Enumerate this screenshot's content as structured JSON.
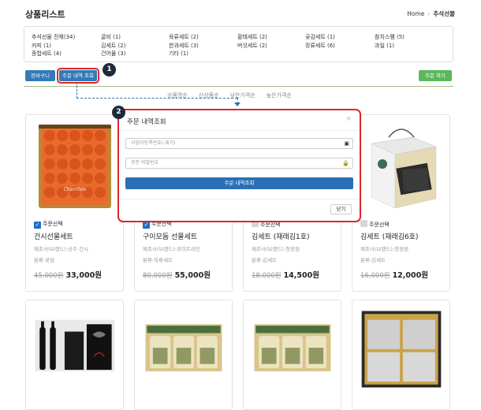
{
  "header": {
    "title": "상품리스트",
    "breadcrumb": [
      "Home",
      "추석선물"
    ]
  },
  "categories": [
    [
      "추석선물 전체(34)",
      "커피 (1)",
      "종합세트 (4)"
    ],
    [
      "굴비 (1)",
      "김세트 (2)",
      "건어물 (3)"
    ],
    [
      "육류세트 (2)",
      "한과세트 (3)",
      "기타 (1)"
    ],
    [
      "황태세트 (2)",
      "버섯세트 (2)"
    ],
    [
      "곶감세트 (1)",
      "장류세트 (6)"
    ],
    [
      "참치스팸 (5)",
      "과일 (1)"
    ]
  ],
  "toolbar": {
    "cart": "장바구니",
    "lookup": "주문 내역 조회",
    "order": "주문 하기"
  },
  "sort": [
    "상품명순",
    "신상품순",
    "낮은가격순",
    "높은가격순"
  ],
  "badges": {
    "one": "1",
    "two": "2"
  },
  "modal": {
    "title": "주문 내역조회",
    "close": "×",
    "bizno_placeholder": "사업자등록번호(-제거)",
    "password_placeholder": "주문 비밀번호",
    "submit": "주문 내역조회",
    "dismiss": "닫기"
  },
  "products": [
    {
      "check": "주문선택",
      "checked": true,
      "name": "건시선물세트",
      "maker": "제조사(브랜드):상주 건시",
      "category": "분류:곶감",
      "old": "45,000원",
      "price": "33,000원"
    },
    {
      "check": "주문선택",
      "checked": true,
      "name": "구이모둠 선물세트",
      "maker": "제조사(브랜드):휴미트라인",
      "category": "분류:육류세트",
      "old": "80,000원",
      "price": "55,000원"
    },
    {
      "check": "주문선택",
      "checked": false,
      "name": "김세트 (재래김1호)",
      "maker": "제조사(브랜드):청정원",
      "category": "분류:김세트",
      "old": "18,000원",
      "price": "14,500원"
    },
    {
      "check": "주문선택",
      "checked": false,
      "name": "김세트 (재래김6호)",
      "maker": "제조사(브랜드):청정원",
      "category": "분류:김세트",
      "old": "16,000원",
      "price": "12,000원"
    }
  ],
  "watermark": "ChamSoo"
}
